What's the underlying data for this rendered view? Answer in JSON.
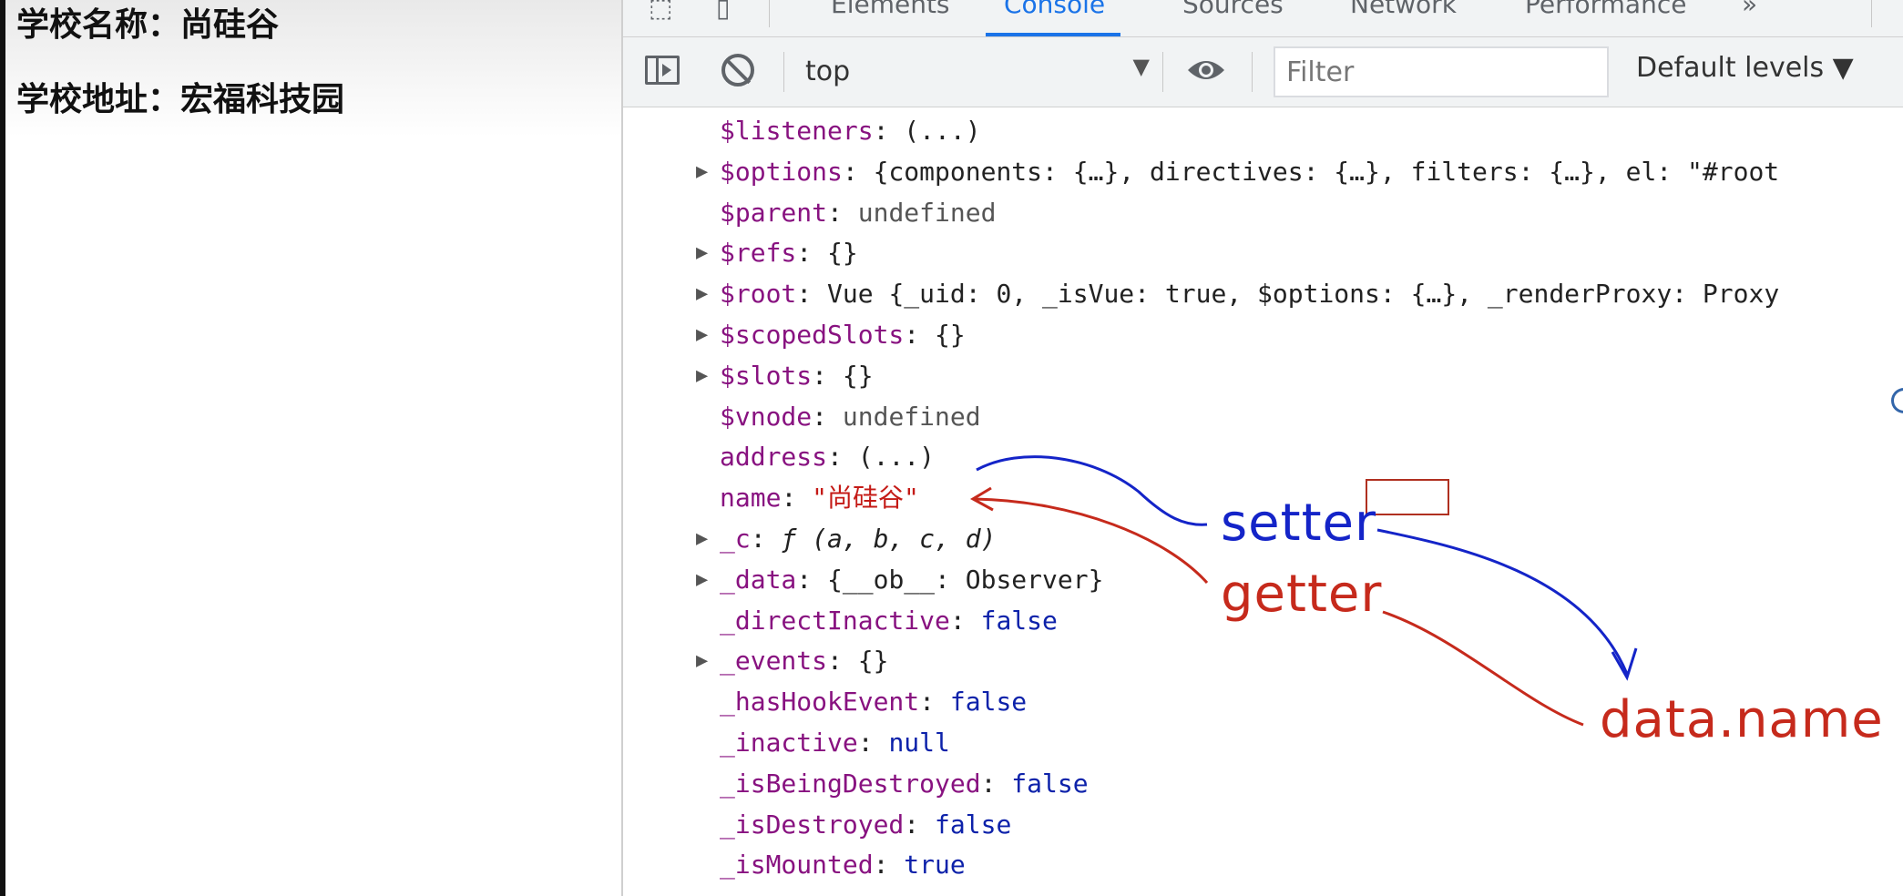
{
  "page": {
    "school_name_label": "学校名称：尚硅谷",
    "school_address_label": "学校地址：宏福科技园"
  },
  "devtools": {
    "tabs": {
      "elements": "Elements",
      "console": "Console",
      "sources": "Sources",
      "network": "Network",
      "performance": "Performance",
      "more": "»"
    },
    "toolbar": {
      "context": "top",
      "context_arrow": "▼",
      "filter_placeholder": "Filter",
      "levels": "Default levels ▼"
    },
    "console_rows": [
      {
        "key": "$listeners",
        "value": "(...)",
        "expandable": false
      },
      {
        "key": "$options",
        "value": "{components: {…}, directives: {…}, filters: {…}, el: \"#root",
        "expandable": true
      },
      {
        "key": "$parent",
        "value": "undefined",
        "expandable": false
      },
      {
        "key": "$refs",
        "value": "{}",
        "expandable": true
      },
      {
        "key": "$root",
        "value": "Vue {_uid: 0, _isVue: true, $options: {…}, _renderProxy: Proxy",
        "expandable": true
      },
      {
        "key": "$scopedSlots",
        "value": "{}",
        "expandable": true
      },
      {
        "key": "$slots",
        "value": "{}",
        "expandable": true
      },
      {
        "key": "$vnode",
        "value": "undefined",
        "expandable": false
      },
      {
        "key": "address",
        "value": "(...)",
        "expandable": false
      },
      {
        "key": "name",
        "value": "\"尚硅谷\"",
        "expandable": false
      },
      {
        "key": "_c",
        "value": "ƒ (a, b, c, d)",
        "expandable": true
      },
      {
        "key": "_data",
        "value": "{__ob__: Observer}",
        "expandable": true
      },
      {
        "key": "_directInactive",
        "value": "false",
        "expandable": false
      },
      {
        "key": "_events",
        "value": "{}",
        "expandable": true
      },
      {
        "key": "_hasHookEvent",
        "value": "false",
        "expandable": false
      },
      {
        "key": "_inactive",
        "value": "null",
        "expandable": false
      },
      {
        "key": "_isBeingDestroyed",
        "value": "false",
        "expandable": false
      },
      {
        "key": "_isDestroyed",
        "value": "false",
        "expandable": false
      },
      {
        "key": "_isMounted",
        "value": "true",
        "expandable": false
      }
    ],
    "expander_glyph": "▶",
    "separator": ": "
  },
  "annotations": {
    "setter": "setter",
    "getter": "getter",
    "data_name": "data.name",
    "colors": {
      "setter": "#1424c8",
      "getter": "#c62a1c"
    }
  }
}
